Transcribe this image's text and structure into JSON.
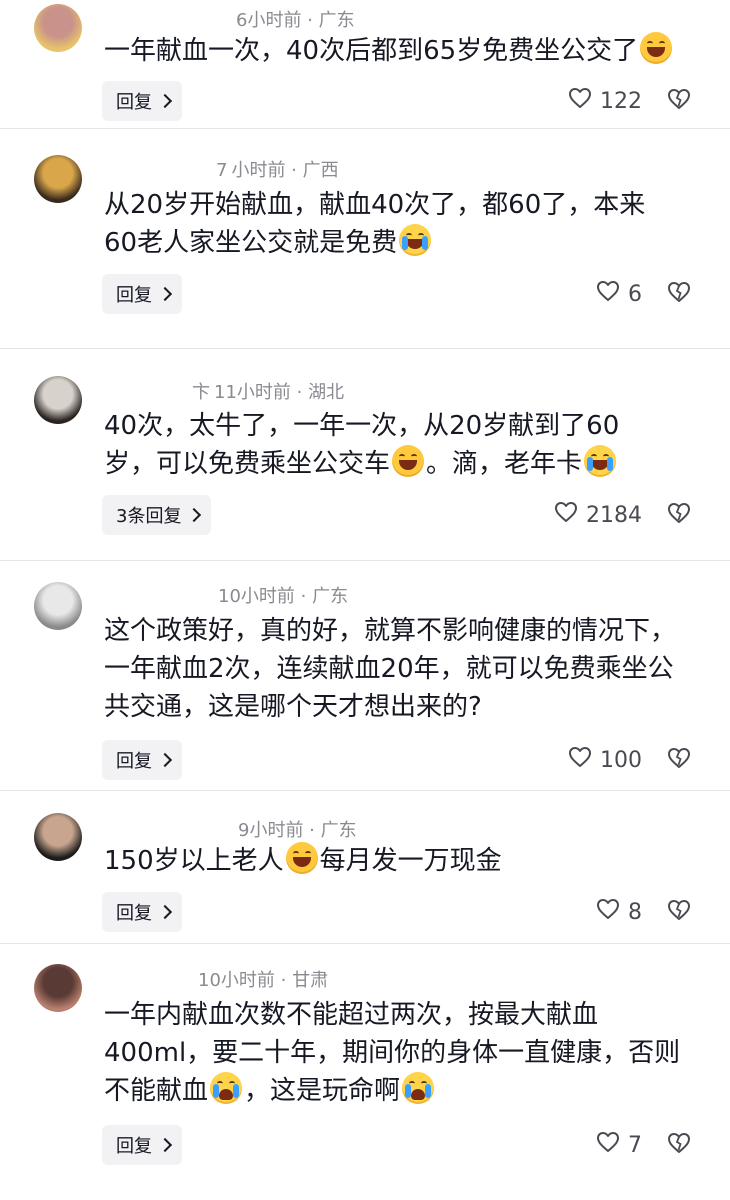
{
  "comments": [
    {
      "meta": "6小时前 · 广东",
      "lines": [
        [
          {
            "t": "一年献血一次，40次后都到65岁免费坐公交了"
          },
          {
            "emoji": "laugh"
          }
        ]
      ],
      "reply_label": "回复",
      "likes": "122",
      "avatar_colors": [
        "#c9928a",
        "#e8c36c"
      ]
    },
    {
      "meta_prefix": "7",
      "meta": "小时前 · 广西",
      "lines": [
        [
          {
            "t": "从20岁开始献血，献血40次了，都60了，本来"
          }
        ],
        [
          {
            "t": "60老人家坐公交就是免费"
          },
          {
            "emoji": "cry-laugh"
          }
        ]
      ],
      "reply_label": "回复",
      "likes": "6",
      "avatar_colors": [
        "#d9a64a",
        "#3a2a1e"
      ]
    },
    {
      "meta_prefix": "卞",
      "meta": "11小时前 · 湖北",
      "lines": [
        [
          {
            "t": "40次，太牛了，一年一次，从20岁献到了60"
          }
        ],
        [
          {
            "t": "岁，可以免费乘坐公交车"
          },
          {
            "emoji": "laugh"
          },
          {
            "t": "。滴，老年卡"
          },
          {
            "emoji": "cry-laugh"
          }
        ]
      ],
      "reply_label": "3条回复",
      "likes": "2184",
      "avatar_colors": [
        "#d8d2cc",
        "#2a2320"
      ]
    },
    {
      "meta": "10小时前 · 广东",
      "lines": [
        [
          {
            "t": "这个政策好，真的好，就算不影响健康的情况下，"
          }
        ],
        [
          {
            "t": "一年献血2次，连续献血20年，就可以免费乘坐公"
          }
        ],
        [
          {
            "t": "共交通，这是哪个天才想出来的?"
          }
        ]
      ],
      "reply_label": "回复",
      "likes": "100",
      "avatar_colors": [
        "#e8e8e8",
        "#8a8a8a"
      ]
    },
    {
      "meta": "9小时前 · 广东",
      "lines": [
        [
          {
            "t": "150岁以上老人"
          },
          {
            "emoji": "laugh"
          },
          {
            "t": "每月发一万现金"
          }
        ]
      ],
      "reply_label": "回复",
      "likes": "8",
      "avatar_colors": [
        "#c7a58e",
        "#1c1c1c"
      ]
    },
    {
      "meta": "10小时前 · 甘肃",
      "lines": [
        [
          {
            "t": "一年内献血次数不能超过两次，按最大献血"
          }
        ],
        [
          {
            "t": "400ml，要二十年，期间你的身体一直健康，否则"
          }
        ],
        [
          {
            "t": "不能献血"
          },
          {
            "emoji": "sob"
          },
          {
            "t": "，这是玩命啊"
          },
          {
            "emoji": "sob"
          }
        ]
      ],
      "reply_label": "回复",
      "likes": "7",
      "avatar_colors": [
        "#5a3a34",
        "#b88070"
      ]
    }
  ],
  "colors": {
    "heart": "#4a4b52",
    "meta": "#8a8b91",
    "reply_bg": "#f2f2f4"
  }
}
